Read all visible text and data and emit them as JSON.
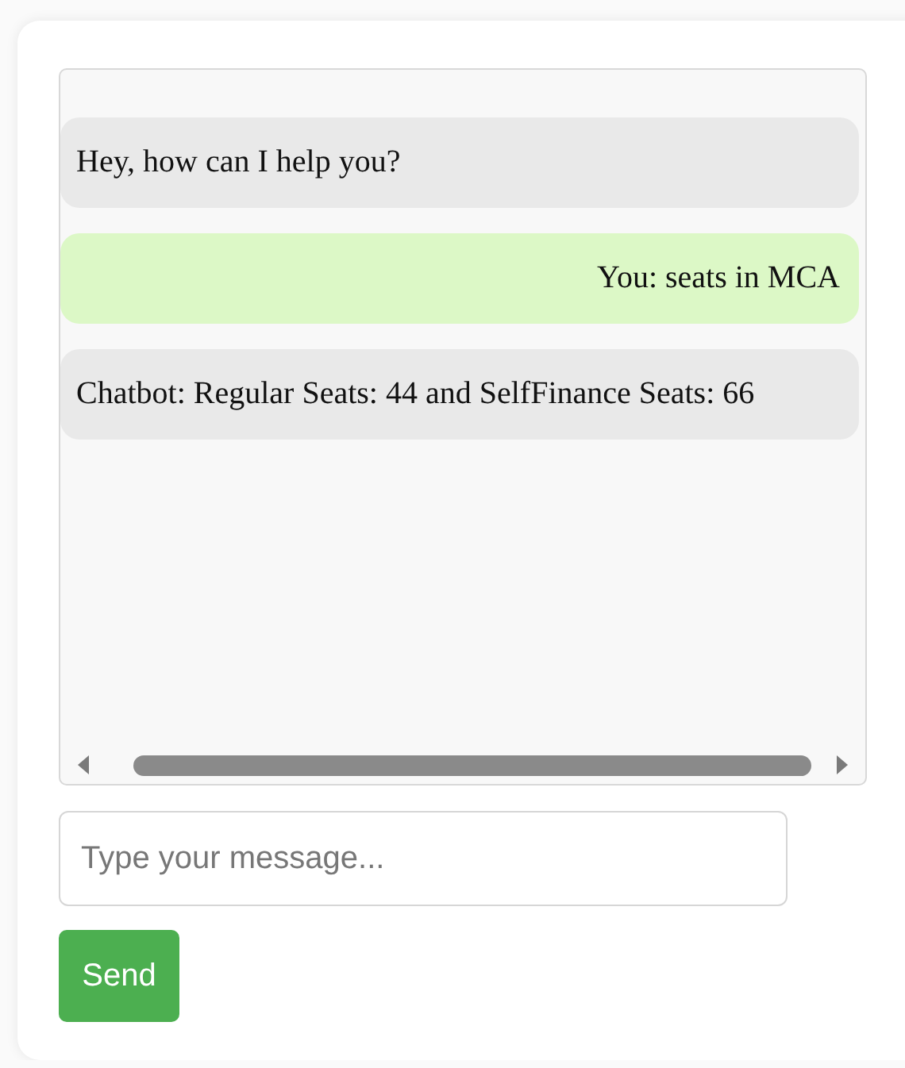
{
  "messages": [
    {
      "kind": "bot",
      "text": "Hey, how can I help you?"
    },
    {
      "kind": "user",
      "text": "You: seats in MCA"
    },
    {
      "kind": "bot",
      "text": "Chatbot: Regular Seats: 44 and SelfFinance Seats: 66"
    }
  ],
  "input": {
    "placeholder": "Type your message..."
  },
  "send_button": {
    "label": "Send"
  }
}
